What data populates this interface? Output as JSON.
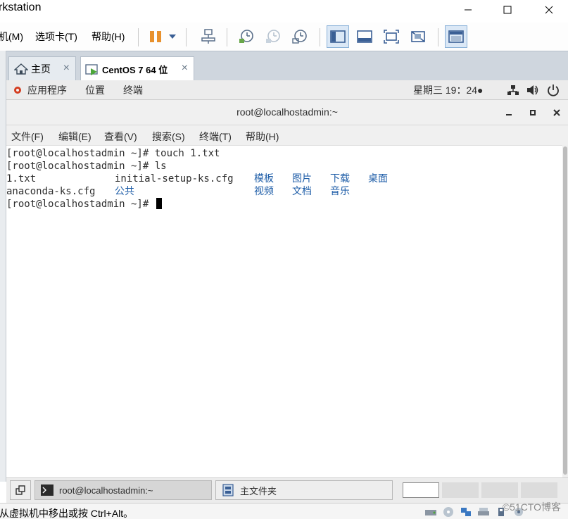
{
  "vmware": {
    "title": "rkstation",
    "menu": {
      "vm": "机(M)",
      "tabs": "选项卡(T)",
      "help": "帮助(H)"
    },
    "tabs": [
      {
        "label": "主页",
        "close": "×"
      },
      {
        "label": "CentOS 7 64 位",
        "close": "×"
      }
    ],
    "status_text": "从虚拟机中移出或按 Ctrl+Alt。",
    "watermark": "©51CTO博客"
  },
  "gnome_panel": {
    "applications": "应用程序",
    "places": "位置",
    "terminal": "终端",
    "clock": "星期三 19：24●"
  },
  "terminal": {
    "title": "root@localhostadmin:~",
    "menu": [
      "文件(F)",
      "编辑(E)",
      "查看(V)",
      "搜索(S)",
      "终端(T)",
      "帮助(H)"
    ],
    "lines": {
      "l1": "[root@localhostadmin ~]# touch 1.txt",
      "l2": "[root@localhostadmin ~]# ls",
      "l3_a": "1.txt",
      "l3_b": "initial-setup-ks.cfg",
      "l3_c": "模板",
      "l3_d": "图片",
      "l3_e": "下载",
      "l3_f": "桌面",
      "l4_a": "anaconda-ks.cfg",
      "l4_b": "公共",
      "l4_c": "视频",
      "l4_d": "文档",
      "l4_e": "音乐",
      "l5": "[root@localhostadmin ~]# "
    }
  },
  "taskbar": {
    "terminal_task": "root@localhostadmin:~",
    "files_task": "主文件夹"
  },
  "colors": {
    "directory_blue": "#1f5ea8",
    "panel_gray": "#ececec",
    "tab_strip": "#cfd6de"
  }
}
